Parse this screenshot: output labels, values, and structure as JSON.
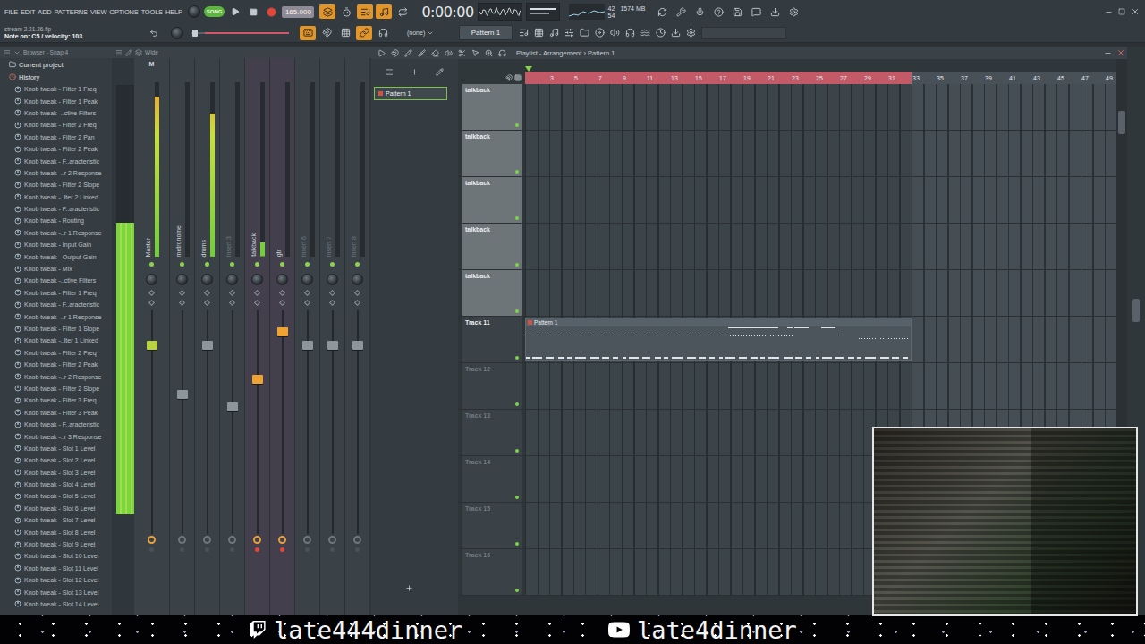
{
  "menu": [
    "FILE",
    "EDIT",
    "ADD",
    "PATTERNS",
    "VIEW",
    "OPTIONS",
    "TOOLS",
    "HELP"
  ],
  "transport": {
    "mode": {
      "label": "SONG",
      "on": true
    },
    "tempo": "165.000",
    "time": "0:00:00"
  },
  "toolbar_top": [
    {
      "on": true
    },
    {
      "on": false
    },
    {
      "on": true
    },
    {
      "on": true
    },
    {
      "on": false
    }
  ],
  "monitor": {
    "cpu": "42",
    "memory": "1574 MB",
    "polyphony": "54"
  },
  "hint": {
    "file": "stream 2.21.26.flp",
    "message": "Note on: C5 / velocity: 103"
  },
  "master_volume": {
    "level": 0.02
  },
  "toolbar_bottom": [
    {
      "on": true
    },
    {
      "on": false
    },
    {
      "on": false
    },
    {
      "on": true
    },
    {
      "on": false
    }
  ],
  "pattern_selector": {
    "value": "(none)"
  },
  "current_pattern": {
    "label": "Pattern 1"
  },
  "browser": {
    "title": "Browser - Snap 4",
    "folders": [
      {
        "label": "Current project"
      },
      {
        "label": "History"
      }
    ],
    "items": [
      "Knob tweak - Filter 1 Freq",
      "Knob tweak - Filter 1 Peak",
      "Knob tweak -..ctive Filters",
      "Knob tweak - Filter 2 Freq",
      "Knob tweak - Filter 2 Pan",
      "Knob tweak - Filter 2 Peak",
      "Knob tweak - F..aracteristic",
      "Knob tweak -..r 2 Response",
      "Knob tweak - Filter 2 Slope",
      "Knob tweak -..lter 2 Linked",
      "Knob tweak - F..aracteristic",
      "Knob tweak - Routing",
      "Knob tweak -..r 1 Response",
      "Knob tweak - Input Gain",
      "Knob tweak - Output Gain",
      "Knob tweak - Mix",
      "Knob tweak -..ctive Filters",
      "Knob tweak - Filter 1 Freq",
      "Knob tweak - F..aracteristic",
      "Knob tweak -..r 1 Response",
      "Knob tweak - Filter 1 Slope",
      "Knob tweak -..lter 1 Linked",
      "Knob tweak - Filter 2 Freq",
      "Knob tweak - Filter 2 Peak",
      "Knob tweak -..r 2 Response",
      "Knob tweak - Filter 2 Slope",
      "Knob tweak - Filter 3 Freq",
      "Knob tweak - Filter 3 Peak",
      "Knob tweak - F..aracteristic",
      "Knob tweak -..r 3 Response",
      "Knob tweak - Slot 1 Level",
      "Knob tweak - Slot 2 Level",
      "Knob tweak - Slot 3 Level",
      "Knob tweak - Slot 4 Level",
      "Knob tweak - Slot 5 Level",
      "Knob tweak - Slot 6 Level",
      "Knob tweak - Slot 7 Level",
      "Knob tweak - Slot 8 Level",
      "Knob tweak - Slot 9 Level",
      "Knob tweak - Slot 10 Level",
      "Knob tweak - Slot 11 Level",
      "Knob tweak - Slot 12 Level",
      "Knob tweak - Slot 13 Level",
      "Knob tweak - Slot 14 Level"
    ]
  },
  "mixer": {
    "title": "Wide",
    "master_tag": "M",
    "master_meter": {
      "level": 0.68
    },
    "channels": [
      {
        "name": "Master",
        "kind": "master",
        "level": 0.92,
        "fader": 0.86,
        "selected": false,
        "dimmed": false,
        "send": true,
        "armed": false
      },
      {
        "name": "metronome",
        "kind": "insert",
        "level": 0,
        "fader": 0.63,
        "selected": false,
        "dimmed": false,
        "send": false,
        "armed": false
      },
      {
        "name": "drums",
        "kind": "insert",
        "level": 0.82,
        "fader": 0.86,
        "selected": false,
        "dimmed": false,
        "send": false,
        "armed": false
      },
      {
        "name": "Insert 3",
        "kind": "insert",
        "level": 0,
        "fader": 0.57,
        "selected": false,
        "dimmed": true,
        "send": false,
        "armed": false
      },
      {
        "name": "talkback",
        "kind": "insert",
        "level": 0.08,
        "fader": 0.7,
        "selected": true,
        "dimmed": false,
        "send": true,
        "armed": true
      },
      {
        "name": "gtr",
        "kind": "insert",
        "level": 0,
        "fader": 0.92,
        "selected": true,
        "dimmed": false,
        "send": true,
        "armed": true
      },
      {
        "name": "Insert 6",
        "kind": "insert",
        "level": 0,
        "fader": 0.86,
        "selected": false,
        "dimmed": true,
        "send": false,
        "armed": false
      },
      {
        "name": "Insert 7",
        "kind": "insert",
        "level": 0,
        "fader": 0.86,
        "selected": false,
        "dimmed": true,
        "send": false,
        "armed": false
      },
      {
        "name": "Insert 8",
        "kind": "insert",
        "level": 0,
        "fader": 0.86,
        "selected": false,
        "dimmed": true,
        "send": false,
        "armed": false
      }
    ]
  },
  "patterns": [
    {
      "label": "Pattern 1",
      "selected": true
    }
  ],
  "playlist": {
    "title": "Playlist - Arrangement",
    "separator": "›",
    "breadcrumb": "Pattern 1",
    "ruler": [
      "3",
      "5",
      "7",
      "9",
      "11",
      "13",
      "15",
      "17",
      "19",
      "21",
      "23",
      "25",
      "27",
      "29",
      "31",
      "33",
      "35",
      "37",
      "39",
      "41",
      "43",
      "45",
      "47",
      "49"
    ],
    "song_end_bar": 33,
    "tracks": [
      {
        "name": "talkback",
        "color": "#6d7579",
        "muted": false,
        "empty": false,
        "clips": []
      },
      {
        "name": "talkback",
        "color": "#6d7579",
        "muted": false,
        "empty": false,
        "clips": []
      },
      {
        "name": "talkback",
        "color": "#6d7579",
        "muted": false,
        "empty": false,
        "clips": []
      },
      {
        "name": "talkback",
        "color": "#6d7579",
        "muted": false,
        "empty": false,
        "clips": []
      },
      {
        "name": "talkback",
        "color": "#6d7579",
        "muted": false,
        "empty": false,
        "clips": []
      },
      {
        "name": "Track 11",
        "color": "#3a4247",
        "muted": false,
        "empty": false,
        "clips": [
          {
            "label": "Pattern 1",
            "start_bar": 1,
            "bars": 32
          }
        ]
      },
      {
        "name": "Track 12",
        "color": "#3a4247",
        "muted": false,
        "empty": true,
        "clips": []
      },
      {
        "name": "Track 13",
        "color": "#3a4247",
        "muted": false,
        "empty": true,
        "clips": []
      },
      {
        "name": "Track 14",
        "color": "#3a4247",
        "muted": false,
        "empty": true,
        "clips": []
      },
      {
        "name": "Track 15",
        "color": "#3a4247",
        "muted": false,
        "empty": true,
        "clips": []
      },
      {
        "name": "Track 16",
        "color": "#3a4247",
        "muted": false,
        "empty": true,
        "clips": []
      }
    ]
  },
  "banner": [
    {
      "kind": "twitch",
      "label": "late444dinner"
    },
    {
      "kind": "youtube",
      "label": "late4dinner"
    }
  ]
}
